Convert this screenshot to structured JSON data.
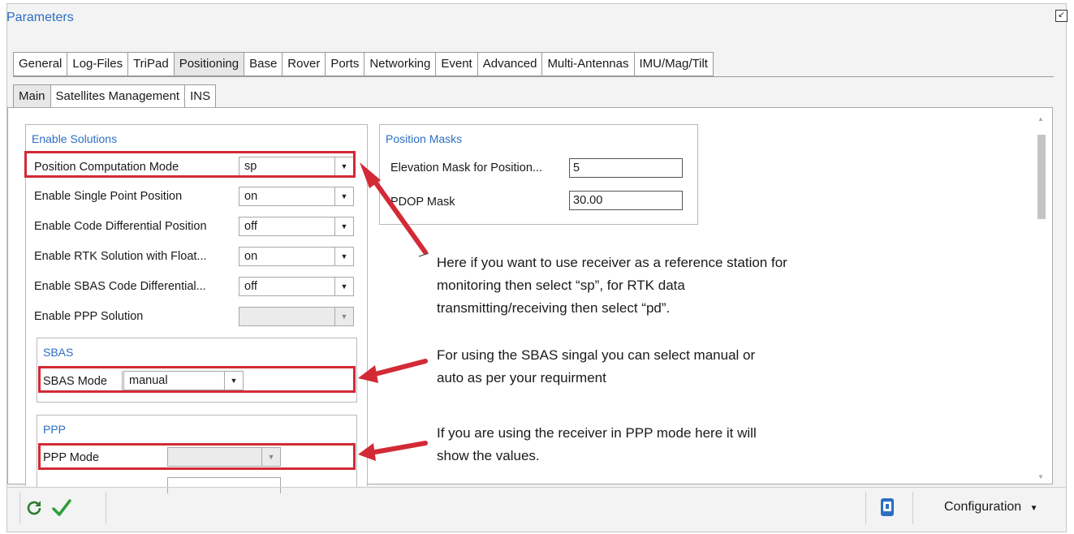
{
  "window": {
    "title": "Parameters"
  },
  "tabs": [
    "General",
    "Log-Files",
    "TriPad",
    "Positioning",
    "Base",
    "Rover",
    "Ports",
    "Networking",
    "Event",
    "Advanced",
    "Multi-Antennas",
    "IMU/Mag/Tilt"
  ],
  "active_tab": "Positioning",
  "subtabs": [
    "Main",
    "Satellites Management",
    "INS"
  ],
  "active_subtab": "Main",
  "enable_solutions": {
    "heading": "Enable Solutions",
    "rows": [
      {
        "label": "Position Computation Mode",
        "value": "sp"
      },
      {
        "label": "Enable Single Point Position",
        "value": "on"
      },
      {
        "label": "Enable Code Differential Position",
        "value": "off"
      },
      {
        "label": "Enable RTK Solution with Float...",
        "value": "on"
      },
      {
        "label": "Enable SBAS Code Differential...",
        "value": "off"
      },
      {
        "label": "Enable PPP Solution",
        "value": ""
      }
    ]
  },
  "sbas": {
    "heading": "SBAS",
    "label": "SBAS Mode",
    "value": "manual"
  },
  "ppp": {
    "heading": "PPP",
    "label": "PPP Mode",
    "value": ""
  },
  "position_masks": {
    "heading": "Position Masks",
    "rows": [
      {
        "label": "Elevation Mask for Position...",
        "value": "5"
      },
      {
        "label": "PDOP Mask",
        "value": "30.00"
      }
    ]
  },
  "annotations": {
    "note1": [
      "Here if you want to use receiver as a reference station for",
      "monitoring then select “sp”, for RTK data",
      "transmitting/receiving then select “pd”."
    ],
    "note2": [
      "For using the SBAS singal you can select manual or",
      "auto as per your requirment"
    ],
    "note3": [
      "If you are using the receiver in PPP mode here it will",
      "show the values."
    ]
  },
  "footer": {
    "refresh_icon": "refresh-icon",
    "apply_icon": "checkmark-icon",
    "device_icon": "device-icon",
    "configuration_label": "Configuration"
  },
  "colors": {
    "accent": "#2c6fc2",
    "highlight": "#d32a36",
    "apply": "#2e9d3a"
  }
}
